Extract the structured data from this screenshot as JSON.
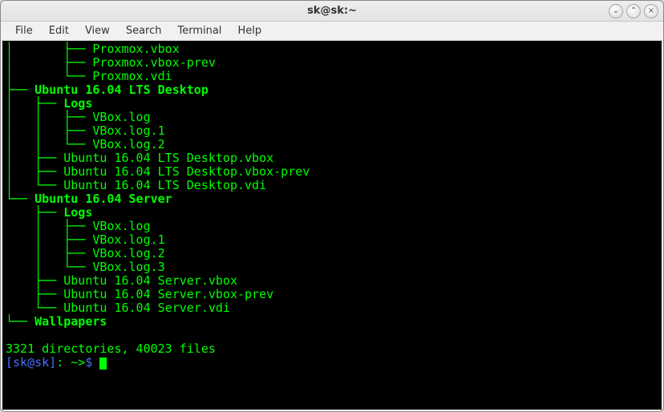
{
  "window": {
    "title": "sk@sk:~"
  },
  "menubar": {
    "items": [
      "File",
      "Edit",
      "View",
      "Search",
      "Terminal",
      "Help"
    ]
  },
  "tree": {
    "lines": [
      "│       ├── Proxmox.vbox",
      "│       ├── Proxmox.vbox-prev",
      "│       └── Proxmox.vdi"
    ],
    "ubuntu_desktop": {
      "header": "├── Ubuntu 16.04 LTS Desktop",
      "logs_header": "│   ├── Logs",
      "logs": [
        "│   │   ├── VBox.log",
        "│   │   ├── VBox.log.1",
        "│   │   └── VBox.log.2"
      ],
      "files": [
        "│   ├── Ubuntu 16.04 LTS Desktop.vbox",
        "│   ├── Ubuntu 16.04 LTS Desktop.vbox-prev",
        "│   └── Ubuntu 16.04 LTS Desktop.vdi"
      ]
    },
    "ubuntu_server": {
      "header": "└── Ubuntu 16.04 Server",
      "logs_header": "    ├── Logs",
      "logs": [
        "    │   ├── VBox.log",
        "    │   ├── VBox.log.1",
        "    │   ├── VBox.log.2",
        "    │   └── VBox.log.3"
      ],
      "files": [
        "    ├── Ubuntu 16.04 Server.vbox",
        "    ├── Ubuntu 16.04 Server.vbox-prev",
        "    └── Ubuntu 16.04 Server.vdi"
      ]
    },
    "wallpapers": "└── Wallpapers"
  },
  "summary": "3321 directories, 40023 files",
  "prompt": {
    "user": "[sk@sk]",
    "sep": ": ",
    "path": "~>",
    "dollar": "$ "
  },
  "window_controls": {
    "minimize": "⌄",
    "maximize": "⌃",
    "close": "×"
  }
}
